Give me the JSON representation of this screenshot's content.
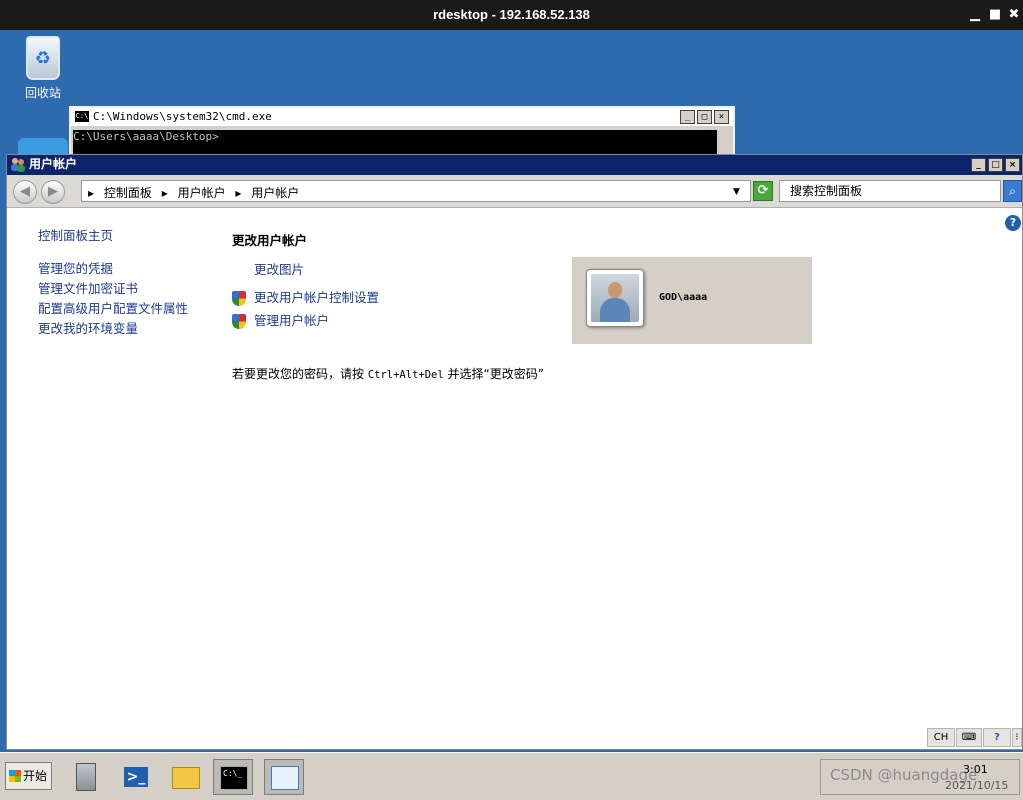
{
  "rdp": {
    "title": "rdesktop - 192.168.52.138",
    "minimize": "▁",
    "maximize": "■",
    "close": "✖"
  },
  "desktop": {
    "recycle_bin_label": "回收站"
  },
  "cmd_window": {
    "title": "C:\\Windows\\system32\\cmd.exe",
    "icon_text": "C:\\",
    "body": "C:\\Users\\aaaa\\Desktop>"
  },
  "window": {
    "title": "用户帐户",
    "breadcrumbs": [
      "控制面板",
      "用户帐户",
      "用户帐户"
    ],
    "search_placeholder": "搜索控制面板"
  },
  "left_pane": {
    "home": "控制面板主页",
    "links": [
      "管理您的凭据",
      "管理文件加密证书",
      "配置高级用户配置文件属性",
      "更改我的环境变量"
    ]
  },
  "main": {
    "heading": "更改用户帐户",
    "tasks": [
      {
        "label": "更改图片",
        "shield": false
      },
      {
        "label": "更改用户帐户控制设置",
        "shield": true
      },
      {
        "label": "管理用户帐户",
        "shield": true
      }
    ],
    "note_prefix": "若要更改您的密码，请按 ",
    "note_keys": "Ctrl+Alt+Del",
    "note_suffix": " 并选择“更改密码”",
    "user_name": "GOD\\aaaa"
  },
  "status_tray": {
    "lang": "CH"
  },
  "taskbar": {
    "start_label": "开始",
    "time": "3:01",
    "date": "2021/10/15"
  },
  "watermark": "CSDN @huangdage",
  "colors": {
    "title_bar": "#0c246a",
    "link": "#1f3a93",
    "desktop": "#2d6aae"
  }
}
